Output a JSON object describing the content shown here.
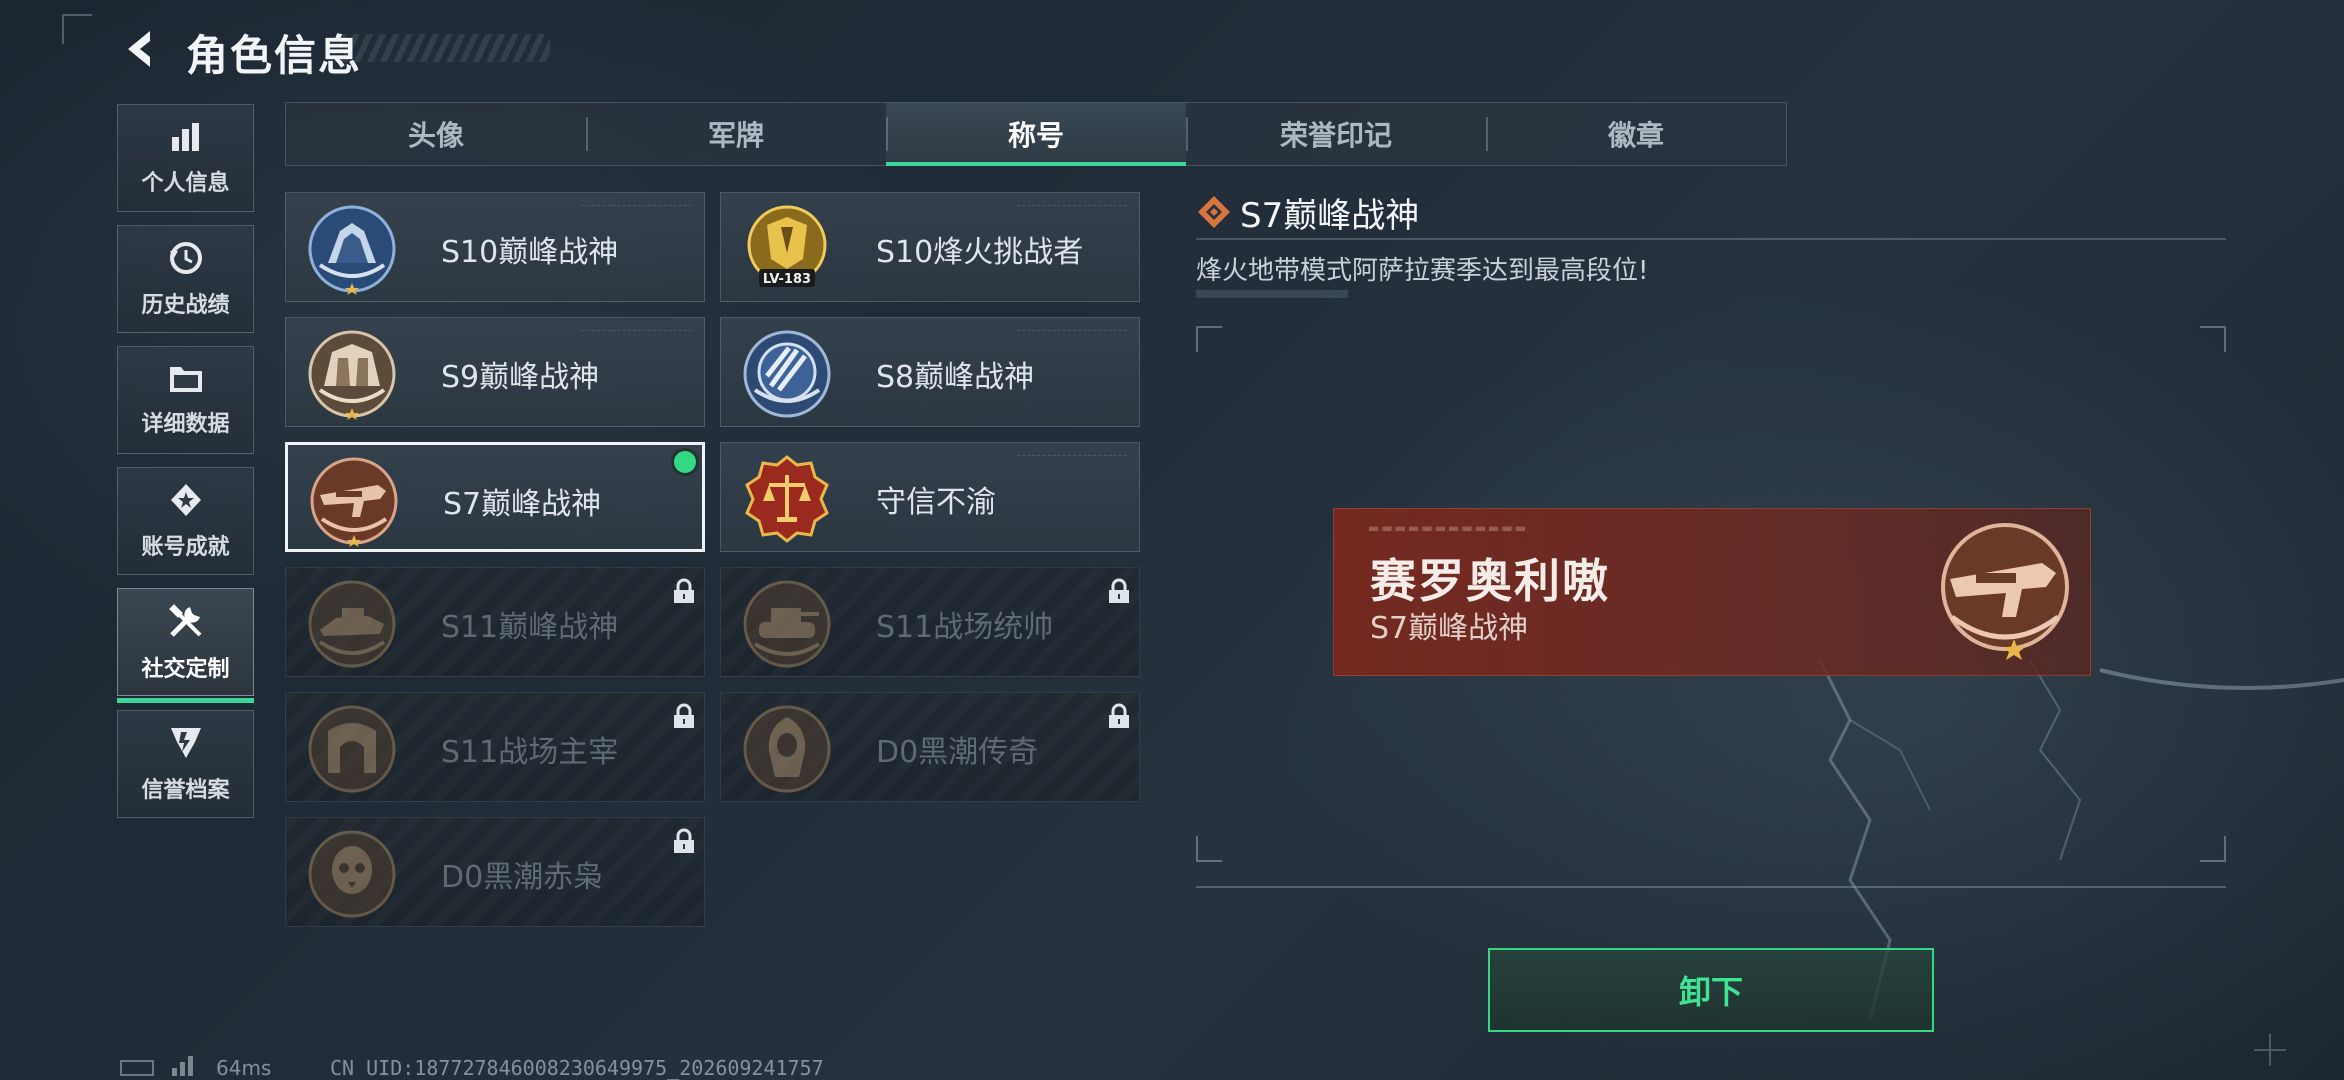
{
  "header": {
    "title": "角色信息"
  },
  "sidebar": {
    "items": [
      {
        "label": "个人信息",
        "icon": "bar-chart-icon"
      },
      {
        "label": "历史战绩",
        "icon": "history-clock-icon"
      },
      {
        "label": "详细数据",
        "icon": "folder-icon"
      },
      {
        "label": "账号成就",
        "icon": "achievement-icon"
      },
      {
        "label": "社交定制",
        "icon": "tools-icon",
        "active": true
      },
      {
        "label": "信誉档案",
        "icon": "credit-shield-icon"
      }
    ]
  },
  "tabs": [
    {
      "label": "头像"
    },
    {
      "label": "军牌"
    },
    {
      "label": "称号",
      "active": true
    },
    {
      "label": "荣誉印记"
    },
    {
      "label": "徽章"
    }
  ],
  "titles": [
    {
      "name": "S10巅峰战神",
      "locked": false
    },
    {
      "name": "S10烽火挑战者",
      "locked": false,
      "badge_text": "LV-183"
    },
    {
      "name": "S9巅峰战神",
      "locked": false
    },
    {
      "name": "S8巅峰战神",
      "locked": false
    },
    {
      "name": "S7巅峰战神",
      "locked": false,
      "selected": true,
      "equipped": true
    },
    {
      "name": "守信不渝",
      "locked": false
    },
    {
      "name": "S11巅峰战神",
      "locked": true
    },
    {
      "name": "S11战场统帅",
      "locked": true
    },
    {
      "name": "S11战场主宰",
      "locked": true
    },
    {
      "name": "D0黑潮传奇",
      "locked": true
    },
    {
      "name": "D0黑潮赤枭",
      "locked": true
    }
  ],
  "detail": {
    "title": "S7巅峰战神",
    "description": "烽火地带模式阿萨拉赛季达到最高段位!",
    "preview": {
      "player_name": "赛罗奥利嗷",
      "title": "S7巅峰战神"
    },
    "unequip_label": "卸下"
  },
  "status": {
    "ping": "64ms",
    "uid": "CN UID:18772784600823064997​5_202609241757"
  },
  "colors": {
    "accent": "#3ed69a",
    "equipped_dot": "#33d884",
    "preview_bg": "#7a2a20"
  }
}
